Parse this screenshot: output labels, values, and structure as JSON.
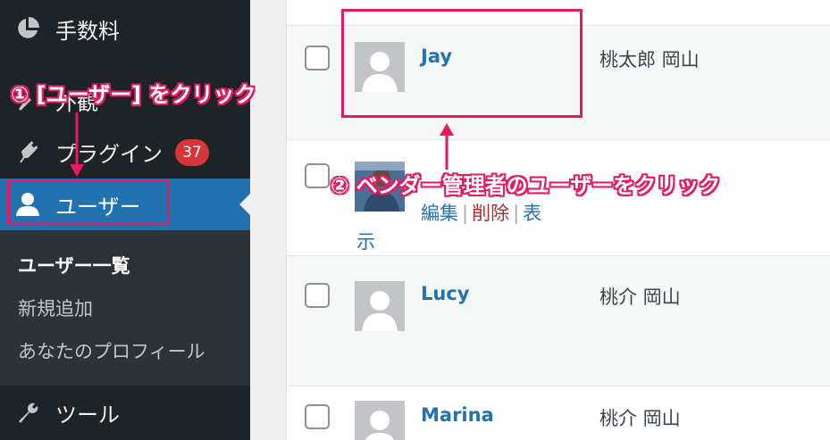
{
  "sidebar": {
    "items": [
      {
        "label": "手数料",
        "icon": "pie-chart-icon"
      },
      {
        "label": "外観",
        "icon": "paintbrush-icon"
      },
      {
        "label": "プラグイン",
        "icon": "plugin-icon",
        "badge": "37"
      },
      {
        "label": "ユーザー",
        "icon": "user-icon"
      },
      {
        "label": "ツール",
        "icon": "wrench-icon"
      }
    ],
    "submenu": [
      "ユーザー一覧",
      "新規追加",
      "あなたのプロフィール"
    ]
  },
  "users_table": {
    "rows": [
      {
        "username": "Jay",
        "name": "桃太郎 岡山"
      },
      {
        "username": "",
        "name": "",
        "actions": {
          "edit": "編集",
          "delete": "削除",
          "view_line1": "表",
          "view_line2": "示"
        }
      },
      {
        "username": "Lucy",
        "name": "桃介 岡山"
      },
      {
        "username": "Marina",
        "name": "桃介 岡山"
      }
    ]
  },
  "annotations": {
    "step1": "① [ユーザー] をクリック",
    "step2": "② ベンダー管理者のユーザーをクリック",
    "color": "#e8195f"
  },
  "colors": {
    "sidebar_bg": "#1d2327",
    "active_bg": "#2271b1",
    "badge": "#d63638",
    "link": "#2271b1",
    "delete": "#b32d2e"
  }
}
